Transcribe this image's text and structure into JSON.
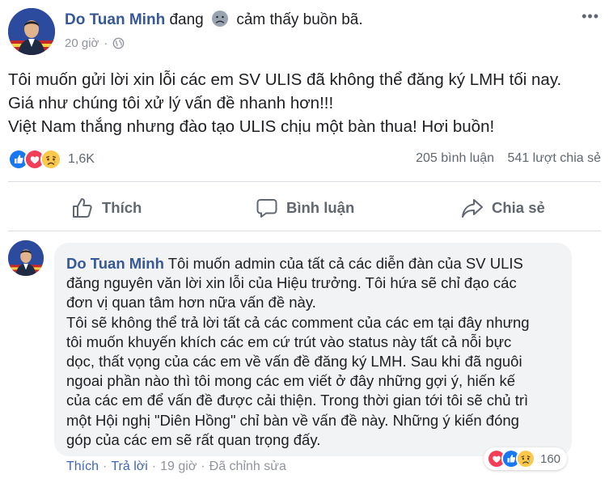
{
  "post": {
    "author": "Do Tuan Minh",
    "feeling_prefix": "đang",
    "feeling_text": "cảm thấy buồn bã.",
    "timestamp": "20 giờ",
    "meta_separator": "·",
    "options_icon": "more-horizontal-icon",
    "lines": [
      "Tôi muốn gửi lời xin lỗi các em SV ULIS đã không thể đăng ký LMH tối nay.",
      "Giá như chúng tôi xử lý vấn đề nhanh hơn!!!",
      "Việt Nam thắng nhưng đào tạo ULIS chịu một bàn thua! Hơi buồn!"
    ],
    "reaction_count": "1,6K",
    "comments_count": "205 bình luận",
    "shares_count": "541 lượt chia sẻ"
  },
  "actions": {
    "like": "Thích",
    "comment": "Bình luận",
    "share": "Chia sẻ"
  },
  "comment": {
    "author": "Do Tuan Minh",
    "first_line": "Tôi muốn admin của tất cả các diễn đàn của SV ULIS",
    "lines": [
      "đăng nguyên văn lời xin lỗi của Hiệu trưởng. Tôi hứa sẽ chỉ đạo các",
      "đơn vị quan tâm hơn nữa vấn đề này.",
      "Tôi sẽ không thể trả lời tất cả các comment của các em tại đây nhưng",
      "tôi muốn khuyến khích các em cứ trút vào status này tất cả nỗi bực",
      "dọc, thất vọng của các em về vấn đề đăng ký LMH. Sau khi đã nguôi",
      "ngoai phần nào thì tôi mong các em viết ở đây những gợi ý, hiến kế",
      "của các em để vấn đề được cải thiện. Trong thời gian tới tôi sẽ chủ trì",
      "một Hội nghị \"Diên Hồng\" chỉ bàn về vấn đề này. Những ý kiến đóng",
      "góp của các em sẽ rất quan trọng đấy."
    ],
    "reaction_count": "160",
    "like_link": "Thích",
    "reply_link": "Trả lời",
    "separator": "·",
    "time": "19 giờ",
    "edited": "Đã chỉnh sửa"
  },
  "colors": {
    "link_blue": "#365899",
    "action_grey": "#606770",
    "bubble_bg": "#f2f3f5",
    "like_blue": "#1877f2",
    "love_red": "#f33e58",
    "sad_yellow": "#fcc94b"
  }
}
